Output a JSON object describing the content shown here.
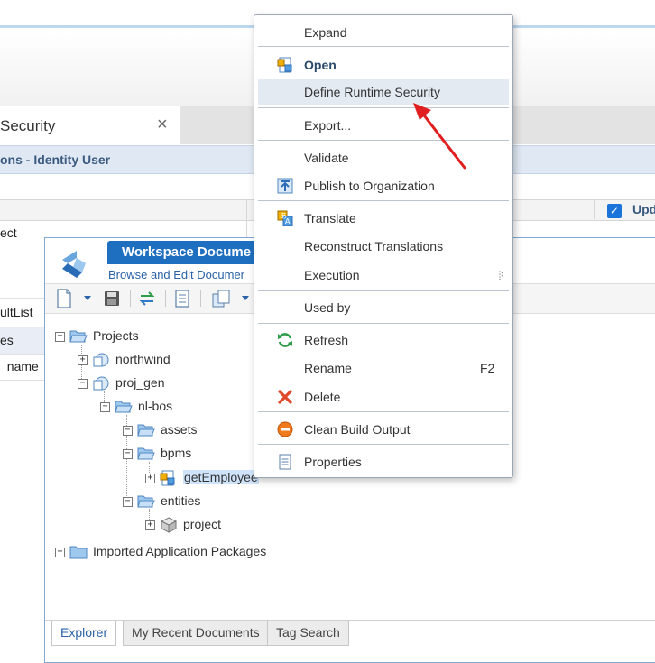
{
  "background": {
    "tab": {
      "title": "Security",
      "close_glyph": "×"
    },
    "panel_title": "ons - Identity User",
    "grid_header_col3": "Upd",
    "rows": [
      {
        "text": "ect"
      },
      {
        "text": "ultList"
      },
      {
        "text": "es"
      },
      {
        "text": "_name"
      }
    ]
  },
  "workspace": {
    "title": "Workspace Docume",
    "subtitle": "Browse and Edit Documer",
    "toolbar_icons": [
      "new-document-icon",
      "save-icon",
      "sync-icon",
      "document-icon",
      "copy-icon"
    ],
    "tree": {
      "projects": "Projects",
      "northwind": "northwind",
      "proj_gen": "proj_gen",
      "nl_bos": "nl-bos",
      "assets": "assets",
      "bpms": "bpms",
      "getEmployee": "getEmployee",
      "entities": "entities",
      "project": "project",
      "imported": "Imported Application Packages"
    },
    "bottom_tabs": [
      "Explorer",
      "My Recent Documents",
      "Tag Search"
    ]
  },
  "context_menu": {
    "items": [
      {
        "id": "expand",
        "label": "Expand"
      },
      {
        "id": "open",
        "label": "Open",
        "icon": "bpm-icon",
        "bold": true
      },
      {
        "id": "define-runtime-security",
        "label": "Define Runtime Security",
        "highlighted": true
      },
      {
        "id": "export",
        "label": "Export..."
      },
      {
        "id": "validate",
        "label": "Validate"
      },
      {
        "id": "publish",
        "label": "Publish to Organization",
        "icon": "publish-icon"
      },
      {
        "id": "translate",
        "label": "Translate",
        "icon": "translate-icon"
      },
      {
        "id": "reconstruct-translations",
        "label": "Reconstruct Translations"
      },
      {
        "id": "execution",
        "label": "Execution",
        "submenu": true
      },
      {
        "id": "used-by",
        "label": "Used by"
      },
      {
        "id": "refresh",
        "label": "Refresh",
        "icon": "refresh-icon"
      },
      {
        "id": "rename",
        "label": "Rename",
        "shortcut": "F2"
      },
      {
        "id": "delete",
        "label": "Delete",
        "icon": "delete-icon"
      },
      {
        "id": "clean-build-output",
        "label": "Clean Build Output",
        "icon": "clean-icon"
      },
      {
        "id": "properties",
        "label": "Properties",
        "icon": "properties-icon"
      }
    ]
  },
  "colors": {
    "accent": "#1f6fc0",
    "highlight": "#e3eaf2",
    "annotation_arrow": "#e02020"
  }
}
